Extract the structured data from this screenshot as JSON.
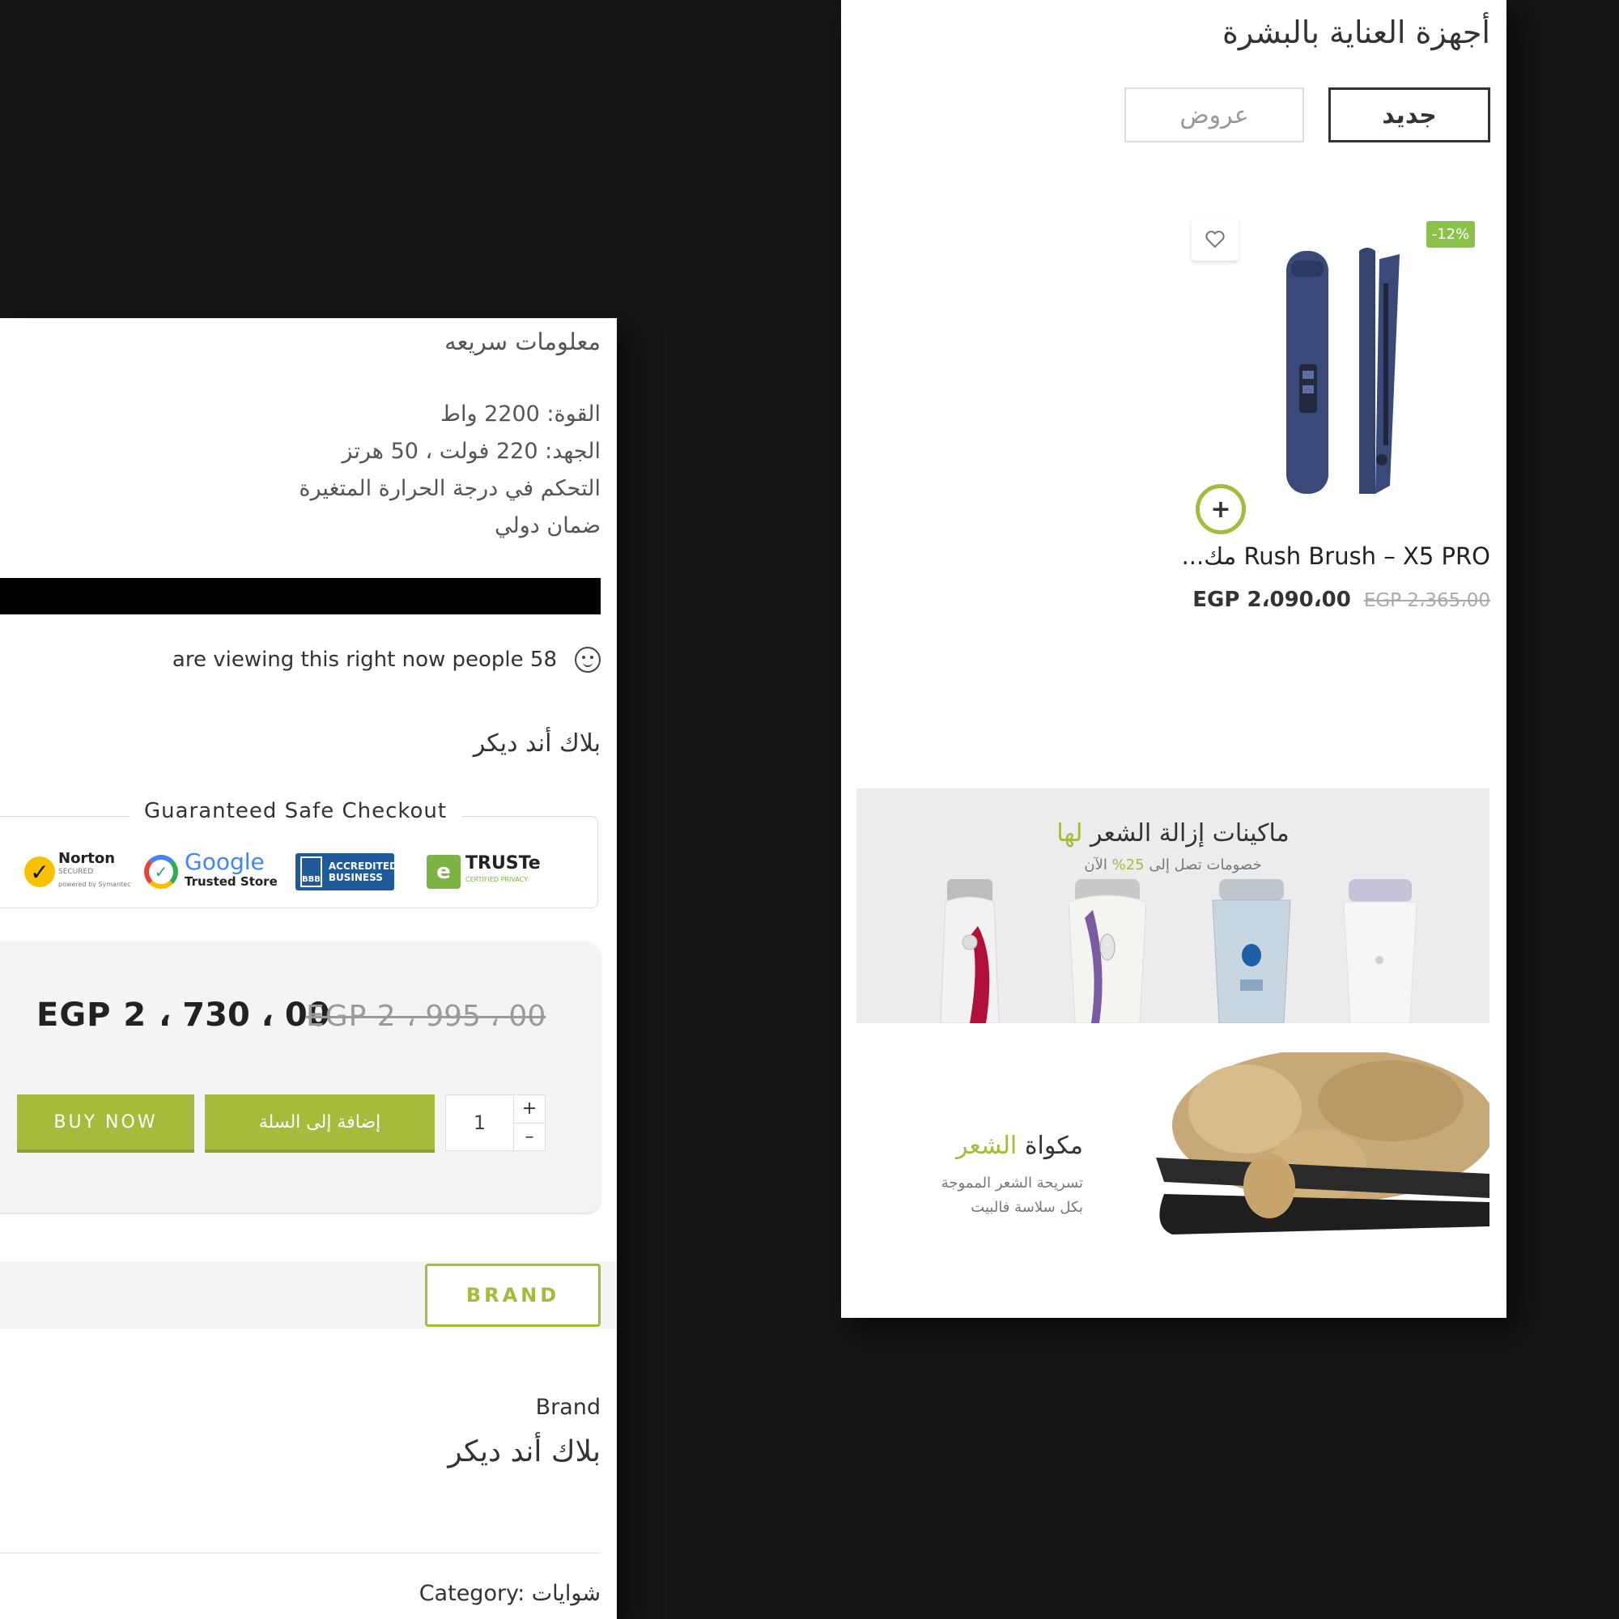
{
  "left": {
    "quick_info_title": "معلومات سريعه",
    "specs": [
      "القوة: 2200 واط",
      "الجهد: 220 فولت ، 50 هرتز",
      "التحكم في درجة الحرارة المتغيرة",
      "ضمان دولي"
    ],
    "viewing_text": "are viewing this right now people 58",
    "brand_heading": "بلاك أند ديكر",
    "checkout_title": "Guaranteed Safe Checkout",
    "badges": {
      "norton": "Norton",
      "norton_sub": "SECURED",
      "norton_powered": "powered by Symantec",
      "google": "Google",
      "google_sub": "Trusted Store",
      "bbb": "ACCREDITED BUSINESS",
      "bbb_mark": "BBB",
      "truste": "TRUSTe",
      "truste_sub": "CERTIFIED PRIVACY"
    },
    "price_now": "EGP 2 ، 730 ، 00",
    "price_old": "EGP 2 ، 995 ، 00",
    "buy_now": "BUY NOW",
    "add_to_cart": "إضافة إلى السلة",
    "quantity": "1",
    "qty_plus": "+",
    "qty_minus": "–",
    "brand_tab": "BRAND",
    "brand_label": "Brand",
    "brand_value": "بلاك أند ديكر",
    "category": "Category: شوايات"
  },
  "right": {
    "title": "أجهزة العناية بالبشرة",
    "tab_new": "جديد",
    "tab_offers": "عروض",
    "discount": "-12%",
    "add_symbol": "+",
    "product_name": "Rush Brush – X5 PRO مك...",
    "price_now": "EGP 2،090،00",
    "price_old": "EGP 2،365،00",
    "banner1_title_main": "ماكينات إزالة الشعر",
    "banner1_title_highlight": "لها",
    "banner1_sub_main": "خصومات تصل إلى",
    "banner1_sub_highlight": "25%",
    "banner1_sub_tail": "الآن",
    "banner2_title_main": "مكواة",
    "banner2_title_highlight": "الشعر",
    "banner2_sub": [
      "تسريحة الشعر المموجة",
      "بكل سلاسة فالبيت"
    ]
  },
  "colors": {
    "accent": "#a6ba3b",
    "discount": "#8bc34a",
    "backdrop": "#161616",
    "product_blue": "#3a4a78"
  },
  "icons": [
    "smiley-icon",
    "heart-icon",
    "plus-icon",
    "norton-check-icon",
    "google-check-icon",
    "bbb-icon",
    "truste-icon"
  ]
}
